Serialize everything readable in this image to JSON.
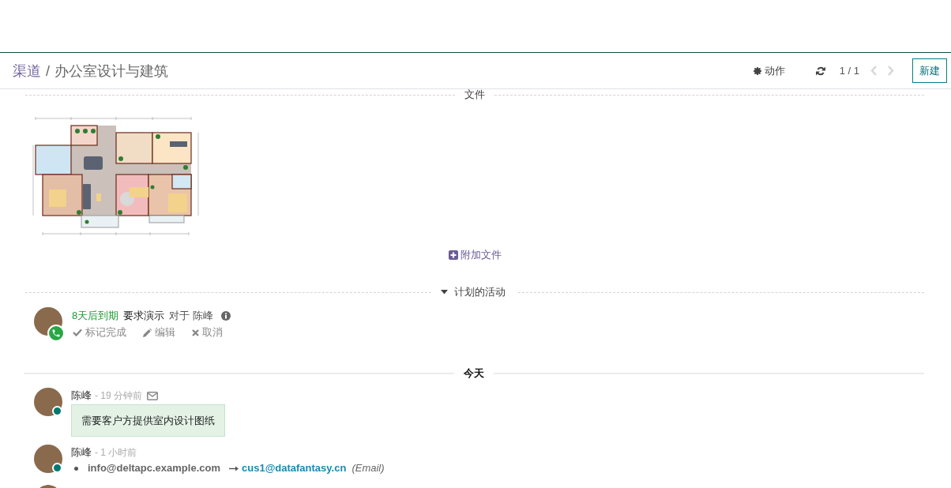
{
  "control_panel": {
    "breadcrumb": [
      {
        "kind": "link",
        "label": "渠道"
      },
      {
        "kind": "current",
        "label": "办公室设计与建筑"
      }
    ],
    "separator": "/",
    "actions_button": "动作",
    "pager": {
      "value": "1 / 1",
      "prev_disabled": true,
      "next_disabled": true
    },
    "new_button": "新建"
  },
  "attachments": {
    "heading": "文件",
    "files": [
      {
        "kind": "image"
      }
    ],
    "attach_button": "附加文件"
  },
  "activities": {
    "heading": "计划的活动",
    "expanded": true,
    "items": [
      {
        "kind": "call",
        "overdue": false,
        "due": "8天后到期",
        "summary": "要求演示",
        "for_label": "对于",
        "assignee": "陈峰",
        "actions": [
          {
            "kind": "done",
            "label": "标记完成"
          },
          {
            "kind": "edit",
            "label": "编辑"
          },
          {
            "kind": "cancel",
            "label": "取消"
          }
        ]
      }
    ]
  },
  "chatter": {
    "date_separator": "今天",
    "messages": [
      {
        "kind": "comment",
        "author": "陈峰",
        "time": "- 19 分钟前",
        "online": true,
        "via_email": true,
        "body": "需要客户方提供室内设计图纸"
      },
      {
        "kind": "tracking",
        "author": "陈峰",
        "time": "- 1 小时前",
        "online": true,
        "changes": [
          {
            "old_value": "info@deltapc.example.com",
            "new_value": "cus1@datafantasy.cn",
            "field": "(Email)"
          }
        ]
      },
      {
        "kind": "cut_off"
      }
    ]
  }
}
